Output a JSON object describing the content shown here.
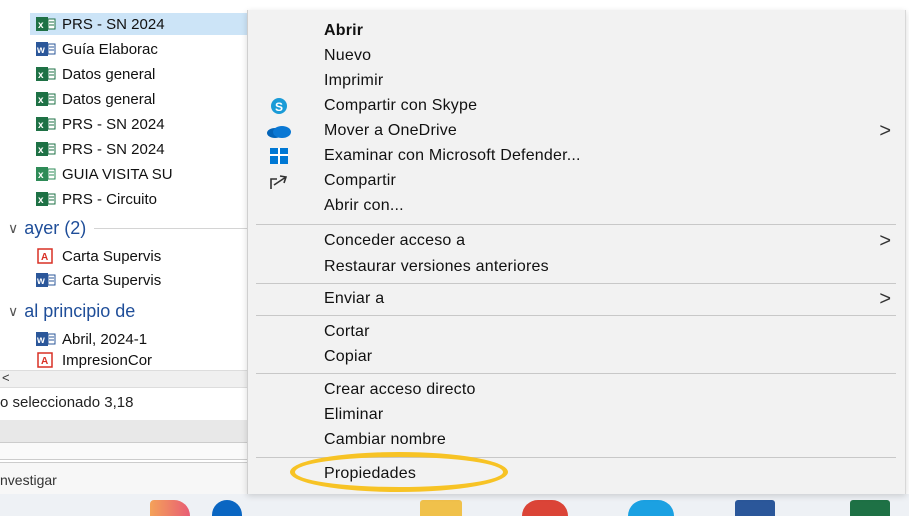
{
  "explorer": {
    "files_today": [
      {
        "name": "PRS - SN 2024",
        "type": "excel",
        "selected": true
      },
      {
        "name": "Guía Elaborac",
        "type": "word"
      },
      {
        "name": "Datos general",
        "type": "excel"
      },
      {
        "name": "Datos general",
        "type": "excel"
      },
      {
        "name": "PRS - SN 2024",
        "type": "excel"
      },
      {
        "name": "PRS - SN 2024",
        "type": "excel"
      },
      {
        "name": "GUIA VISITA SU",
        "type": "excel"
      },
      {
        "name": "PRS - Circuito",
        "type": "excel"
      }
    ],
    "group_yesterday": "ayer (2)",
    "files_yesterday": [
      {
        "name": "Carta Supervis",
        "type": "pdf"
      },
      {
        "name": "Carta Supervis",
        "type": "word"
      }
    ],
    "group_earlier": "al principio de",
    "files_earlier": [
      {
        "name": "Abril, 2024-1",
        "type": "word"
      },
      {
        "name": "ImpresionCor",
        "type": "pdf"
      }
    ],
    "scroll_left": "<",
    "status_text": "o seleccionado  3,18",
    "search_text": "nvestigar"
  },
  "menu": {
    "items": [
      {
        "label": "Abrir",
        "bold": true,
        "icon": ""
      },
      {
        "label": "Nuevo",
        "icon": ""
      },
      {
        "label": "Imprimir",
        "icon": ""
      },
      {
        "label": "Compartir con Skype",
        "icon": "skype-icon"
      },
      {
        "label": "Mover a OneDrive",
        "icon": "onedrive-icon",
        "submenu": true
      },
      {
        "label": "Examinar con Microsoft Defender...",
        "icon": "defender-icon"
      },
      {
        "label": "Compartir",
        "icon": "share-icon"
      },
      {
        "label": "Abrir con...",
        "icon": ""
      },
      {
        "label": "Conceder acceso a",
        "icon": "",
        "submenu": true
      },
      {
        "label": "Restaurar versiones anteriores",
        "icon": ""
      },
      {
        "label": "Enviar a",
        "icon": "",
        "submenu": true
      },
      {
        "label": "Cortar",
        "icon": ""
      },
      {
        "label": "Copiar",
        "icon": ""
      },
      {
        "label": "Crear acceso directo",
        "icon": ""
      },
      {
        "label": "Eliminar",
        "icon": ""
      },
      {
        "label": "Cambiar nombre",
        "icon": ""
      },
      {
        "label": "Propiedades",
        "icon": ""
      }
    ],
    "submenu_arrow": ">"
  },
  "colors": {
    "excel": "#1e7145",
    "word": "#2b579a",
    "pdf": "#d93025",
    "highlight": "#f7c325",
    "group_header": "#1f4e99"
  }
}
